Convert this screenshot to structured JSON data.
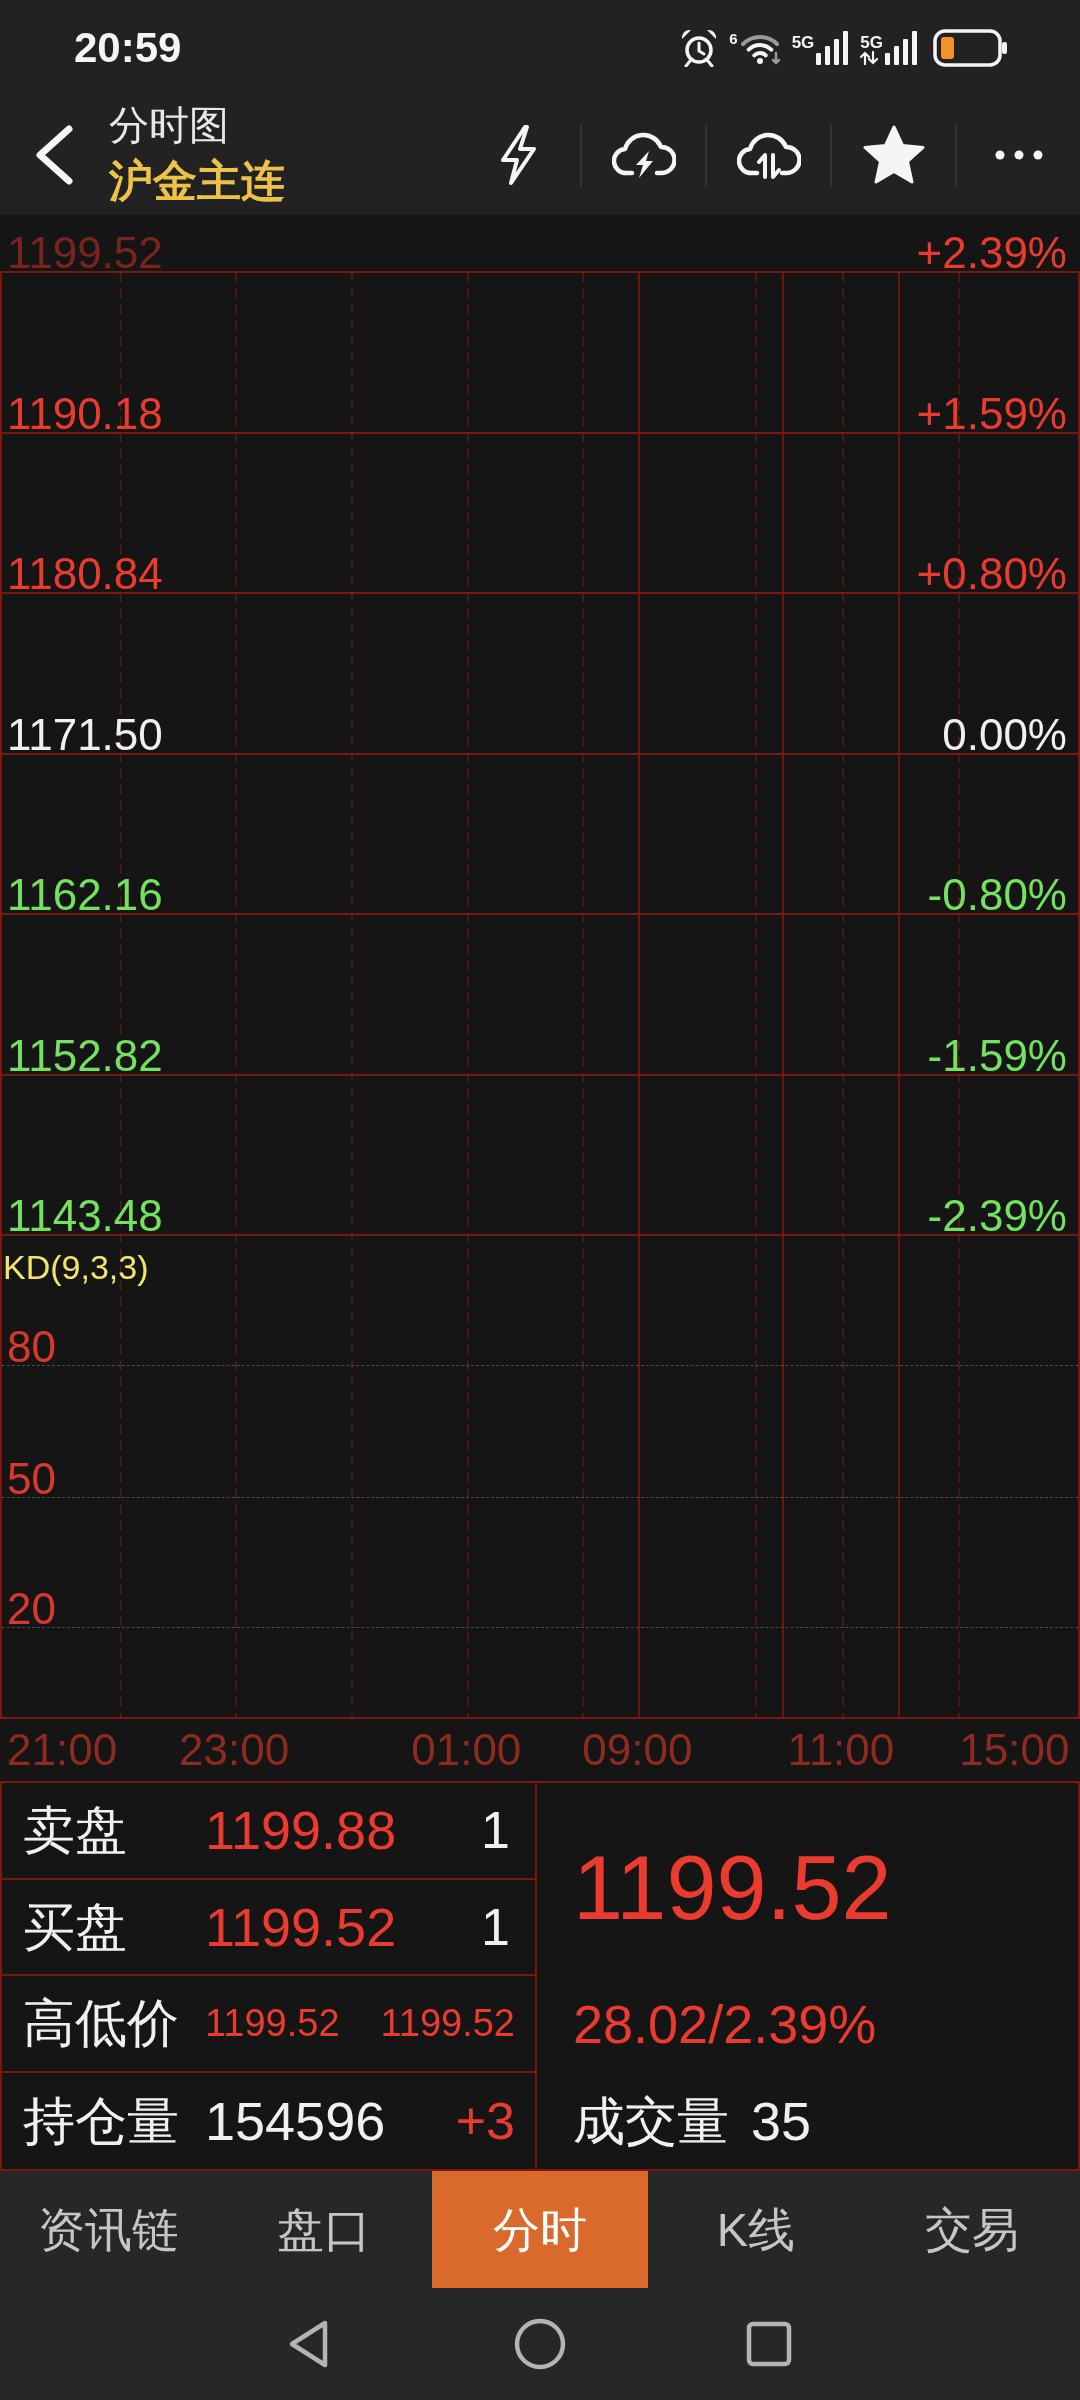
{
  "status_bar": {
    "time": "20:59",
    "wifi_standard": "6",
    "networks": [
      {
        "label": "5G",
        "activity": false
      },
      {
        "label": "5G",
        "activity": true
      }
    ]
  },
  "header": {
    "title": "分时图",
    "instrument": "沪金主连",
    "favorited": true
  },
  "price_axis": [
    {
      "price": "1199.52",
      "percent": "+2.39%",
      "kind": "up",
      "faded": true
    },
    {
      "price": "1190.18",
      "percent": "+1.59%",
      "kind": "up",
      "faded": false
    },
    {
      "price": "1180.84",
      "percent": "+0.80%",
      "kind": "up",
      "faded": false
    },
    {
      "price": "1171.50",
      "percent": "0.00%",
      "kind": "flat",
      "faded": false
    },
    {
      "price": "1162.16",
      "percent": "-0.80%",
      "kind": "down",
      "faded": false
    },
    {
      "price": "1152.82",
      "percent": "-1.59%",
      "kind": "down",
      "faded": false
    },
    {
      "price": "1143.48",
      "percent": "-2.39%",
      "kind": "down",
      "faded": false
    }
  ],
  "indicator": {
    "title": "KD(9,3,3)",
    "levels": [
      "80",
      "50",
      "20"
    ]
  },
  "time_axis": [
    "21:00",
    "23:00",
    "01:00",
    "09:00",
    "11:00",
    "15:00"
  ],
  "quote": {
    "ask": {
      "label": "卖盘",
      "price": "1199.88",
      "volume": "1"
    },
    "bid": {
      "label": "买盘",
      "price": "1199.52",
      "volume": "1"
    },
    "high_low": {
      "label": "高低价",
      "high": "1199.52",
      "low": "1199.52"
    },
    "open_interest": {
      "label": "持仓量",
      "value": "154596",
      "change": "+3"
    },
    "last_price": "1199.52",
    "change": "28.02/2.39%",
    "volume": {
      "label": "成交量",
      "value": "35"
    }
  },
  "tabs": [
    {
      "label": "资讯链",
      "selected": false
    },
    {
      "label": "盘口",
      "selected": false
    },
    {
      "label": "分时",
      "selected": true
    },
    {
      "label": "K线",
      "selected": false
    },
    {
      "label": "交易",
      "selected": false
    }
  ]
}
